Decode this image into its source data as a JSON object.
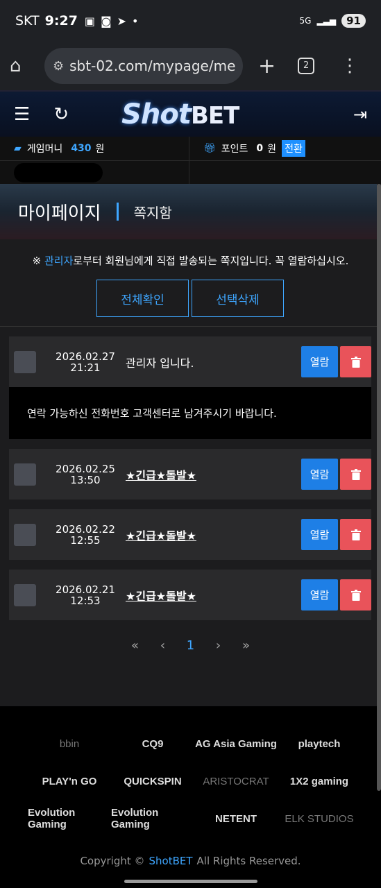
{
  "status": {
    "carrier": "SKT",
    "time": "9:27",
    "battery": "91",
    "network": "5G"
  },
  "browser": {
    "url": "sbt-02.com/mypage/me",
    "tab_count": "2"
  },
  "header": {
    "logo_shot": "Shot",
    "logo_bet": "BET"
  },
  "wallet": {
    "game_money_label": "게임머니",
    "game_money_value": "430",
    "game_money_unit": "원",
    "point_label": "포인트",
    "point_value": "0",
    "point_unit": "원",
    "convert_label": "전환"
  },
  "banner": {
    "title": "마이페이지",
    "subtitle": "쪽지함"
  },
  "notice": {
    "prefix": "※ ",
    "highlight": "관리자",
    "rest": "로부터 회원님에게 직접 발송되는 쪽지입니다. 꼭 열람하십시오."
  },
  "buttons": {
    "check_all": "전체확인",
    "delete_selected": "선택삭제"
  },
  "messages": [
    {
      "date": "2026.02.27",
      "time": "21:21",
      "subject": "관리자 입니다.",
      "open_label": "열람"
    },
    {
      "date": "2026.02.25",
      "time": "13:50",
      "subject": "★긴급★돌발★",
      "open_label": "열람"
    },
    {
      "date": "2026.02.22",
      "time": "12:55",
      "subject": "★긴급★돌발★",
      "open_label": "열람"
    },
    {
      "date": "2026.02.21",
      "time": "12:53",
      "subject": "★긴급★돌발★",
      "open_label": "열람"
    }
  ],
  "message_body": "연락 가능하신 전화번호 고객센터로 남겨주시기 바랍니다.",
  "pager": {
    "first": "«",
    "prev": "‹",
    "current": "1",
    "next": "›",
    "last": "»"
  },
  "providers": [
    "bbin",
    "CQ9",
    "AG Asia Gaming",
    "playtech",
    "PLAY'n GO",
    "QUICKSPIN",
    "ARISTOCRAT",
    "1X2 gaming",
    "Evolution Gaming",
    "Evolution Gaming",
    "NETENT",
    "ELK STUDIOS"
  ],
  "footer": {
    "copyright_prefix": "Copyright ©",
    "brand": "ShotBET",
    "copyright_suffix": "All Rights Reserved."
  }
}
